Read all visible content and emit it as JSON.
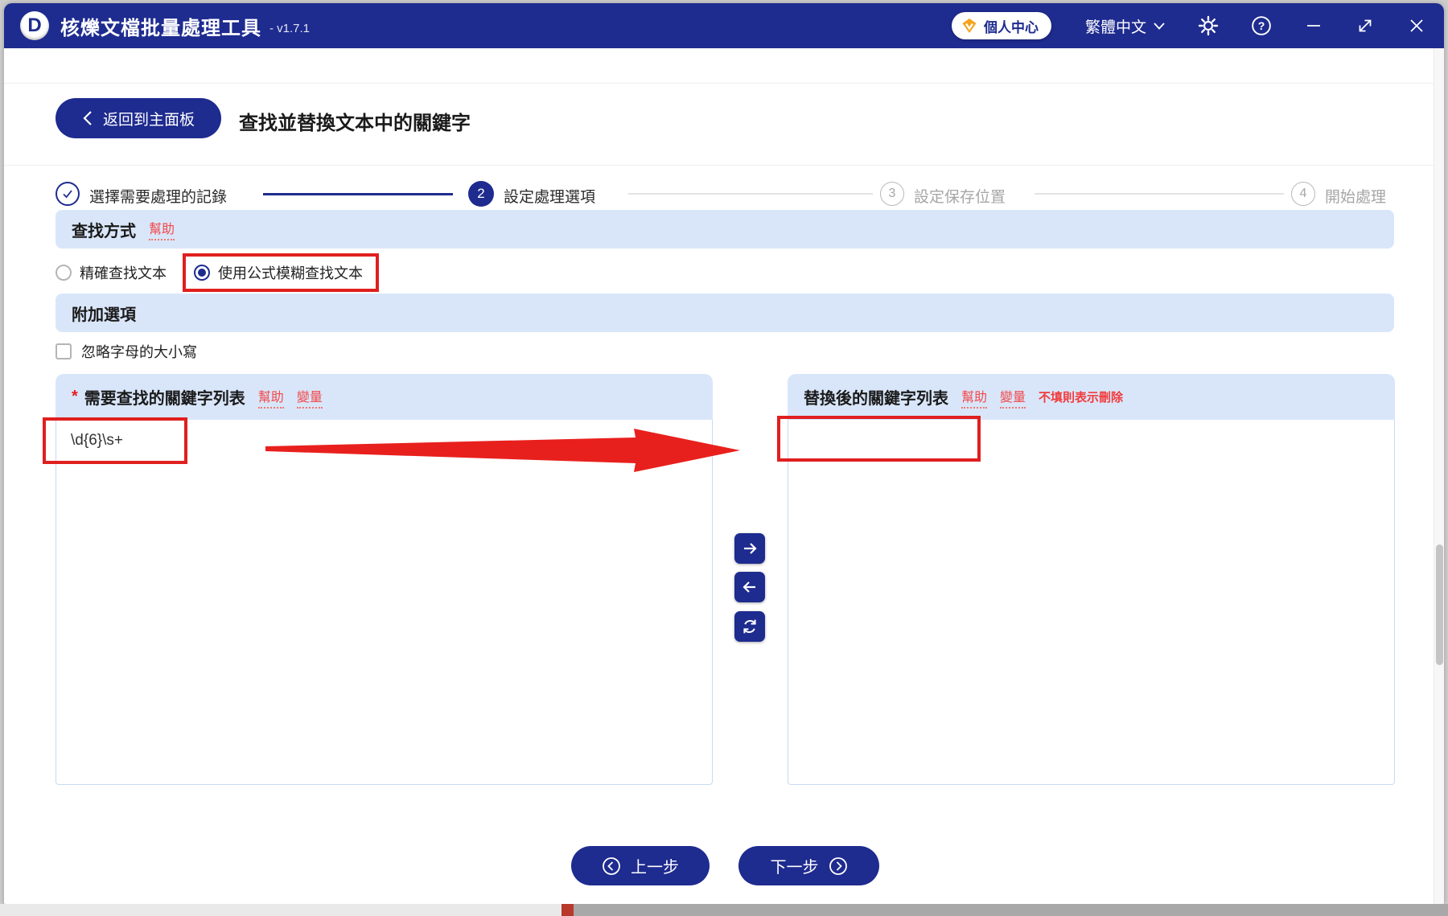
{
  "titlebar": {
    "logo_letter": "D",
    "app_title": "核爍文檔批量處理工具",
    "version": "- v1.7.1",
    "user_center_label": "個人中心",
    "language_label": "繁體中文"
  },
  "header": {
    "back_button_label": "返回到主面板",
    "page_title": "查找並替換文本中的關鍵字"
  },
  "steps": [
    {
      "num": "1",
      "label": "選擇需要處理的記錄",
      "state": "done"
    },
    {
      "num": "2",
      "label": "設定處理選項",
      "state": "active"
    },
    {
      "num": "3",
      "label": "設定保存位置",
      "state": "pending"
    },
    {
      "num": "4",
      "label": "開始處理",
      "state": "pending"
    }
  ],
  "find_mode": {
    "section_title": "查找方式",
    "help_link": "幫助",
    "options": [
      {
        "label": "精確查找文本",
        "selected": false
      },
      {
        "label": "使用公式模糊查找文本",
        "selected": true
      }
    ]
  },
  "extra_options": {
    "section_title": "附加選項",
    "ignore_case_label": "忽略字母的大小寫",
    "checked": false
  },
  "find_panel": {
    "required_mark": "*",
    "title": "需要查找的關鍵字列表",
    "help_link": "幫助",
    "variable_link": "變量",
    "content": "\\d{6}\\s+"
  },
  "replace_panel": {
    "title": "替換後的關鍵字列表",
    "help_link": "幫助",
    "variable_link": "變量",
    "empty_note": "不填則表示刪除",
    "content": ""
  },
  "footer": {
    "prev_label": "上一步",
    "next_label": "下一步"
  },
  "colors": {
    "primary_blue": "#1e2b8f",
    "section_bg": "#d9e6fa",
    "link_red": "#f24a4a",
    "annotation_red": "#e01f1f",
    "vip_orange": "#f6a21d"
  }
}
